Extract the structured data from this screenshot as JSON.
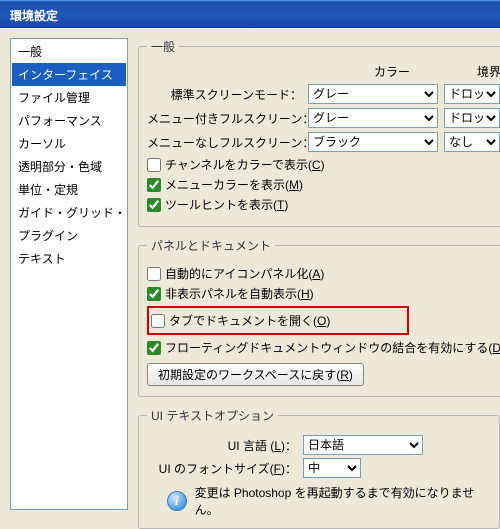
{
  "window": {
    "title": "環境設定"
  },
  "sidebar": {
    "items": [
      "一般",
      "インターフェイス",
      "ファイル管理",
      "パフォーマンス",
      "カーソル",
      "透明部分・色域",
      "単位・定規",
      "ガイド・グリッド・スライス",
      "プラグイン",
      "テキスト"
    ],
    "selected_index": 1
  },
  "general": {
    "legend": "一般",
    "header_color": "カラー",
    "header_border": "境界線",
    "rows": [
      {
        "label": "標準スクリーンモード：",
        "color": "グレー",
        "border": "ドロップシャドウ"
      },
      {
        "label": "メニュー付きフルスクリーン：",
        "color": "グレー",
        "border": "ドロップシャドウ"
      },
      {
        "label": "メニューなしフルスクリーン：",
        "color": "ブラック",
        "border": "なし"
      }
    ],
    "checks": [
      {
        "checked": false,
        "text": "チャンネルをカラーで表示(",
        "u": "C",
        "after": ")"
      },
      {
        "checked": true,
        "text": "メニューカラーを表示(",
        "u": "M",
        "after": ")"
      },
      {
        "checked": true,
        "text": "ツールヒントを表示(",
        "u": "T",
        "after": ")"
      }
    ]
  },
  "panels": {
    "legend": "パネルとドキュメント",
    "checks": [
      {
        "checked": false,
        "text": "自動的にアイコンパネル化(",
        "u": "A",
        "after": ")"
      },
      {
        "checked": true,
        "text": "非表示パネルを自動表示(",
        "u": "H",
        "after": ")"
      },
      {
        "checked": false,
        "text": "タブでドキュメントを開く(",
        "u": "O",
        "after": ")",
        "highlight": true
      },
      {
        "checked": true,
        "text": "フローティングドキュメントウィンドウの結合を有効にする(",
        "u": "D",
        "after": ")"
      }
    ],
    "reset_button": "初期設定のワークスペースに戻す(R)",
    "reset_u": "R"
  },
  "uitext": {
    "legend": "UI テキストオプション",
    "lang_label": "UI 言語",
    "lang_u": "L",
    "lang_value": "日本語",
    "font_label": "UI のフォントサイズ(",
    "font_u": "F",
    "font_after": ")：",
    "font_value": "中",
    "info": "変更は Photoshop を再起動するまで有効になりません。"
  }
}
